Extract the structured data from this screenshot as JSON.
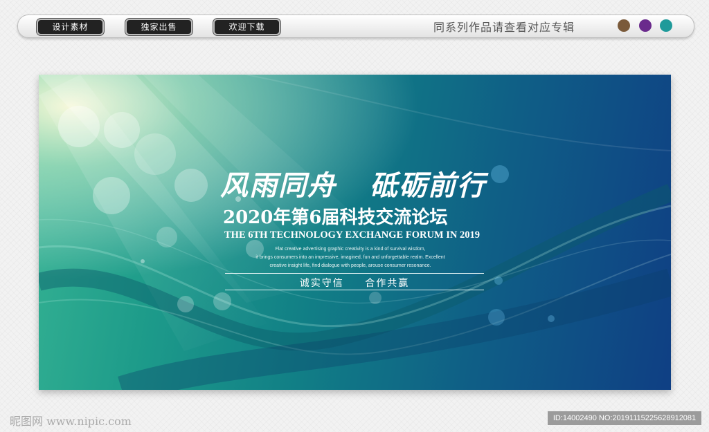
{
  "toolbar": {
    "buttons": [
      "设计素材",
      "独家出售",
      "欢迎下载"
    ],
    "series_note": "同系列作品请查看对应专辑",
    "color_dots": [
      "#7a5a3a",
      "#6a2a8c",
      "#1f9a9a"
    ]
  },
  "banner": {
    "headline_part1": "风雨同舟",
    "headline_part2": "砥砺前行",
    "title_cn": "2020年第6届科技交流论坛",
    "title_en": "THE 6TH TECHNOLOGY EXCHANGE FORUM IN 2019",
    "description": [
      "Flat creative advertising graphic creativity is a kind of survival wisdom,",
      "it brings consumers into an impressive, imagined, fun and unforgettable realm. Excellent",
      "creative insight life, find dialogue with people, arouse consumer resonance."
    ],
    "slogan_left": "诚实守信",
    "slogan_right": "合作共赢"
  },
  "footer": {
    "watermark_left": "昵图网 www.nipic.com",
    "watermark_right": "ID:14002490 NO:20191115225628912081"
  }
}
